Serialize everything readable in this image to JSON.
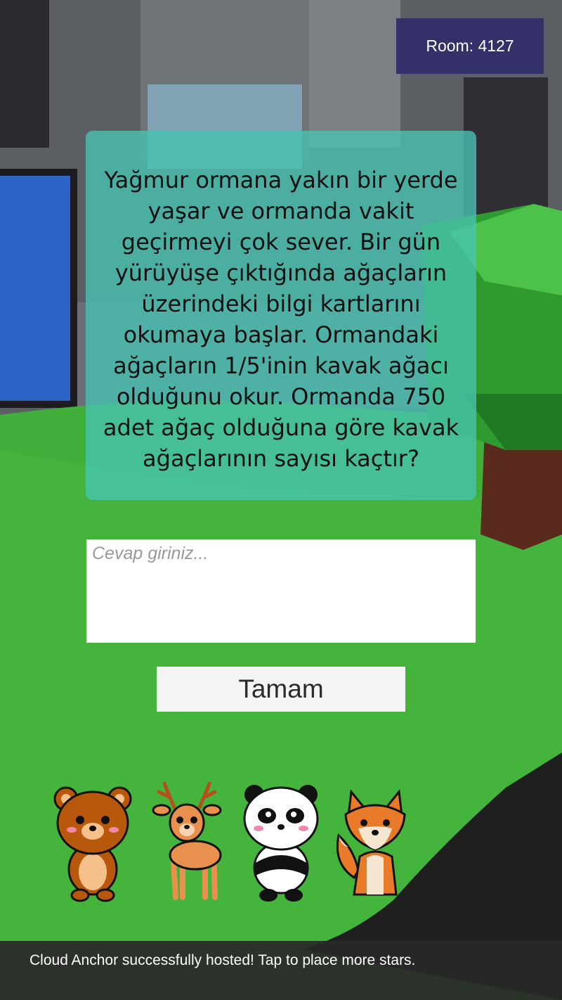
{
  "room": {
    "label": "Room: 4127"
  },
  "question": {
    "text": "Yağmur ormana yakın bir yerde yaşar ve ormanda vakit geçirmeyi çok sever. Bir gün yürüyüşe çıktığında ağaçların üzerindeki bilgi kartlarını okumaya başlar. Ormandaki ağaçların 1/5'inin kavak ağacı olduğunu okur. Ormanda 750 adet ağaç olduğuna göre kavak ağaçlarının sayısı kaçtır?"
  },
  "answer": {
    "placeholder": "Cevap giriniz...",
    "value": ""
  },
  "submit": {
    "label": "Tamam"
  },
  "characters": [
    {
      "kind": "bear-icon"
    },
    {
      "kind": "deer-icon"
    },
    {
      "kind": "panda-icon"
    },
    {
      "kind": "fox-icon"
    }
  ],
  "status": {
    "message": "Cloud Anchor successfully hosted! Tap to place more stars."
  },
  "colors": {
    "room_badge": "#34306a",
    "panel": "#48c4b2",
    "grass": "#3fae3a",
    "tree_leaves": "#2f9a2f",
    "tree_trunk": "#5a2a1c"
  }
}
